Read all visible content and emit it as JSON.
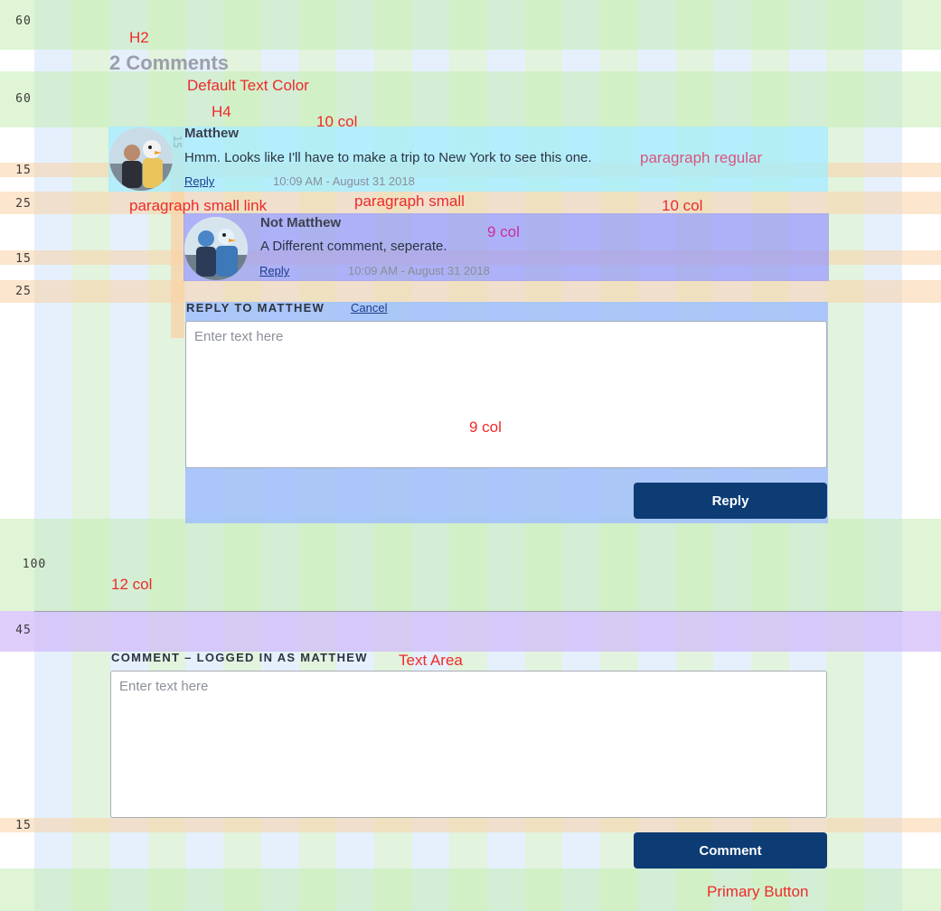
{
  "spacing_labels": {
    "s60a": "60",
    "s60b": "60",
    "s15a": "15",
    "s25a": "25",
    "s15b": "15",
    "s25b": "25",
    "s100": "100",
    "s45": "45",
    "s15c": "15",
    "s15_vertical": "15"
  },
  "annotations": {
    "h2": "H2",
    "default_text_color": "Default Text Color",
    "h4": "H4",
    "ten_col_a": "10 col",
    "paragraph_regular": "paragraph regular",
    "paragraph_small_link": "paragraph small link",
    "paragraph_small": "paragraph small",
    "ten_col_b": "10 col",
    "nine_col_a": "9 col",
    "nine_col_b": "9 col",
    "twelve_col": "12 col",
    "text_area": "Text Area",
    "primary_button": "Primary Button"
  },
  "comments_heading": "2 Comments",
  "comments": [
    {
      "author": "Matthew",
      "text": "Hmm. Looks like I'll have to make a trip to New York to see this one.",
      "reply_label": "Reply",
      "timestamp": "10:09 AM - August 31 2018"
    },
    {
      "author": "Not Matthew",
      "text": "A Different comment, seperate.",
      "reply_label": "Reply",
      "timestamp": "10:09 AM - August 31 2018"
    }
  ],
  "reply_form": {
    "heading": "REPLY TO MATTHEW",
    "cancel_label": "Cancel",
    "placeholder": "Enter text here",
    "value": "",
    "submit_label": "Reply"
  },
  "comment_form": {
    "heading": "COMMENT – LOGGED IN AS MATTHEW",
    "placeholder": "Enter text here",
    "value": "",
    "submit_label": "Comment"
  },
  "colors": {
    "primary_button": "#0d3c74",
    "link": "#1c3c8a",
    "heading_grey": "#9b9fa8",
    "annotation_red": "#ee2a2a"
  }
}
